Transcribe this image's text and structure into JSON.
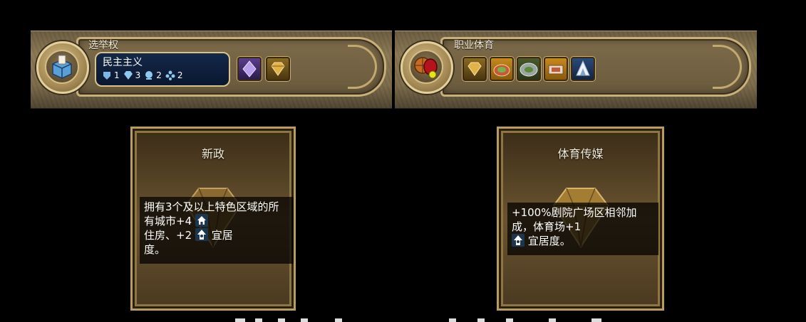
{
  "banner_left": {
    "title": "选举权",
    "government": "民主主义",
    "policy_slots": [
      {
        "icon": "military-slot-icon",
        "count": "1"
      },
      {
        "icon": "economic-slot-icon",
        "count": "3"
      },
      {
        "icon": "diplomatic-slot-icon",
        "count": "2"
      },
      {
        "icon": "wildcard-slot-icon",
        "count": "2"
      }
    ],
    "cards": [
      "wildcard-card-icon",
      "golden-age-card-icon"
    ]
  },
  "banner_right": {
    "title": "职业体育",
    "cards": [
      "golden-age-card-icon",
      "stadium-icon",
      "arena-icon",
      "theater-district-icon",
      "winter-sports-icon"
    ]
  },
  "card_left": {
    "title": "新政",
    "desc_1": "拥有3个及以上特色区域的所有城市+4",
    "desc_2": "住房、+2",
    "desc_3": "宜居",
    "desc_4": "度。"
  },
  "card_right": {
    "title": "体育传媒",
    "desc_1": "+100%剧院广场区相邻加成，体育场+1",
    "desc_2": "宜居度。"
  },
  "colors": {
    "gold": "#c9b07a",
    "gov_blue": "#142848"
  }
}
